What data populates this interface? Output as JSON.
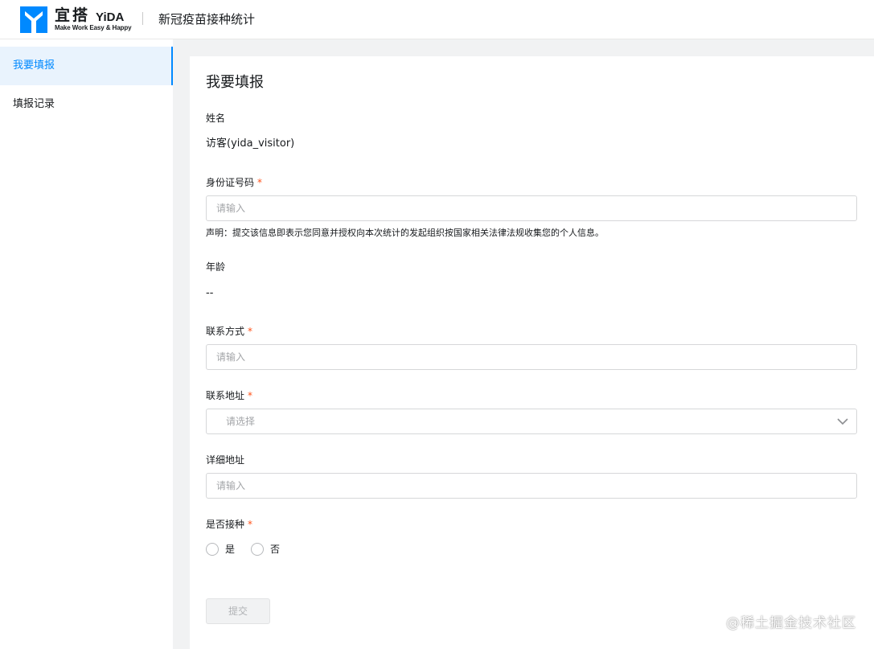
{
  "header": {
    "brand_cn": "宜搭",
    "brand_en": "YiDA",
    "brand_tagline": "Make Work Easy & Happy",
    "app_title": "新冠疫苗接种统计",
    "brand_color": "#0089ff"
  },
  "sidebar": {
    "items": [
      {
        "label": "我要填报",
        "active": true
      },
      {
        "label": "填报记录",
        "active": false
      }
    ]
  },
  "form": {
    "title": "我要填报",
    "name": {
      "label": "姓名",
      "value": "访客(yida_visitor)"
    },
    "id_number": {
      "label": "身份证号码",
      "required": "*",
      "placeholder": "请输入",
      "notice": "声明：提交该信息即表示您同意并授权向本次统计的发起组织按国家相关法律法规收集您的个人信息。"
    },
    "age": {
      "label": "年龄",
      "value": "--"
    },
    "contact": {
      "label": "联系方式",
      "required": "*",
      "placeholder": "请输入"
    },
    "address": {
      "label": "联系地址",
      "required": "*",
      "placeholder": "请选择",
      "icon": "chevron-down-icon"
    },
    "detail_address": {
      "label": "详细地址",
      "placeholder": "请输入"
    },
    "vaccinated": {
      "label": "是否接种",
      "required": "*",
      "options": [
        "是",
        "否"
      ]
    },
    "submit_label": "提交"
  },
  "watermark": "@稀土掘金技术社区"
}
